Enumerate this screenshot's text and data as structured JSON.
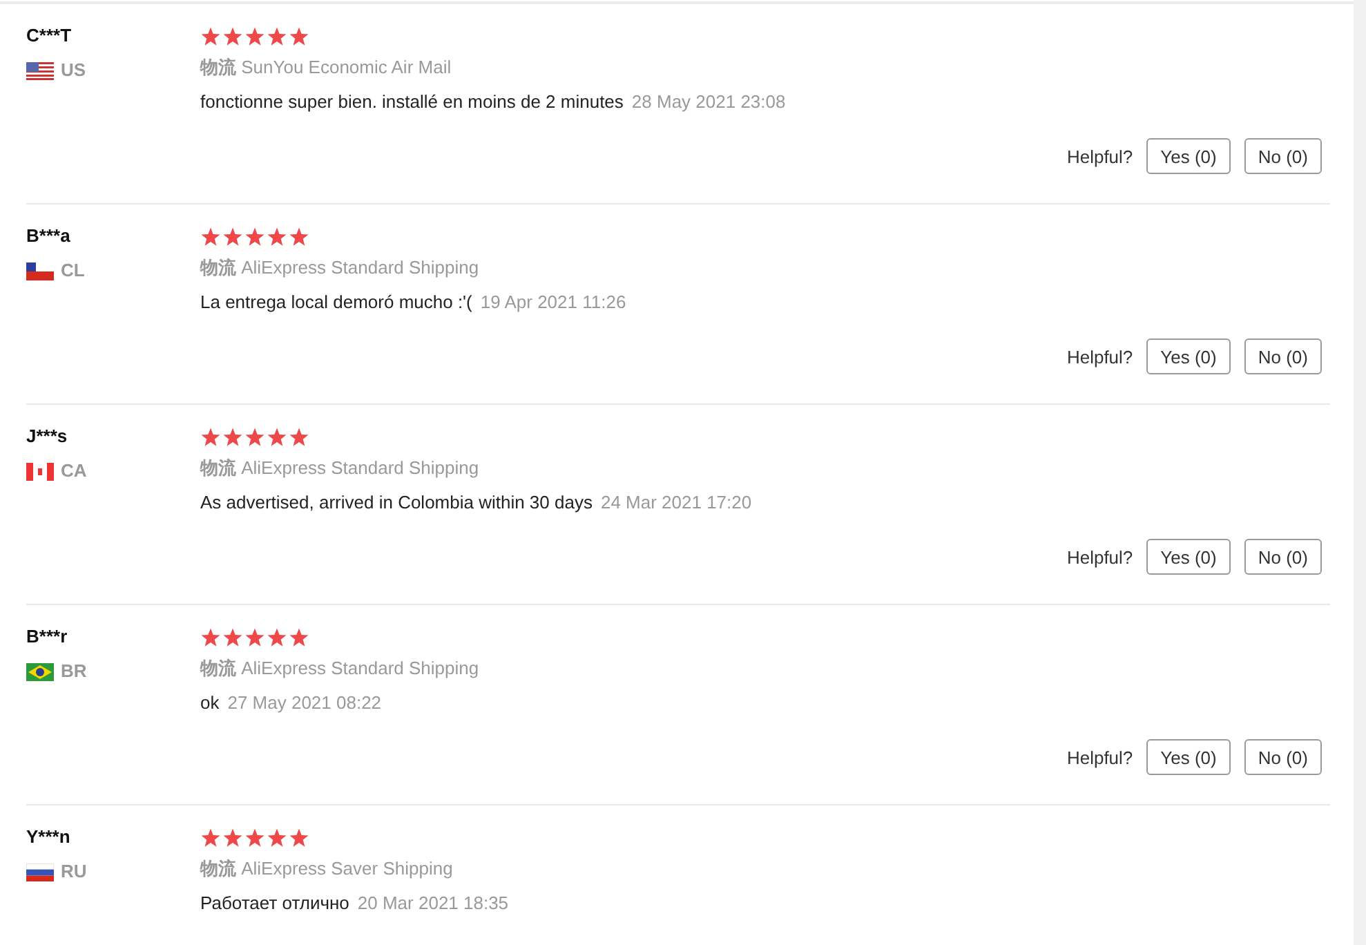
{
  "reviews": [
    {
      "name": "C***T",
      "flag": {
        "kind": "us"
      },
      "country": "US",
      "stars": 5,
      "shipping": "**物流** SunYou Economic Air Mail",
      "comment": "fonctionne super bien. installé en moins de 2 minutes",
      "date": "28 May 2021 23:08",
      "helpful": {
        "label": "Helpful?",
        "yes": "Yes (0)",
        "no": "No (0)"
      }
    },
    {
      "name": "B***a",
      "flag": {
        "kind": "cl"
      },
      "country": "CL",
      "stars": 5,
      "shipping": "**物流** AliExpress Standard Shipping",
      "comment": "La entrega local demoró mucho :'(",
      "date": "19 Apr 2021 11:26",
      "helpful": {
        "label": "Helpful?",
        "yes": "Yes (0)",
        "no": "No (0)"
      }
    },
    {
      "name": "J***s",
      "flag": {
        "kind": "ca"
      },
      "country": "CA",
      "stars": 5,
      "shipping": "**物流** AliExpress Standard Shipping",
      "comment": "As advertised, arrived in Colombia within 30 days",
      "date": "24 Mar 2021 17:20",
      "helpful": {
        "label": "Helpful?",
        "yes": "Yes (0)",
        "no": "No (0)"
      }
    },
    {
      "name": "B***r",
      "flag": {
        "kind": "br"
      },
      "country": "BR",
      "stars": 5,
      "shipping": "**物流** AliExpress Standard Shipping",
      "comment": "ok",
      "date": "27 May 2021 08:22",
      "helpful": {
        "label": "Helpful?",
        "yes": "Yes (0)",
        "no": "No (0)"
      }
    },
    {
      "name": "Y***n",
      "flag": {
        "kind": "ru"
      },
      "country": "RU",
      "stars": 5,
      "shipping": "**物流** AliExpress Saver Shipping",
      "comment": "Работает отлично",
      "date": "20 Mar 2021 18:35"
    }
  ]
}
